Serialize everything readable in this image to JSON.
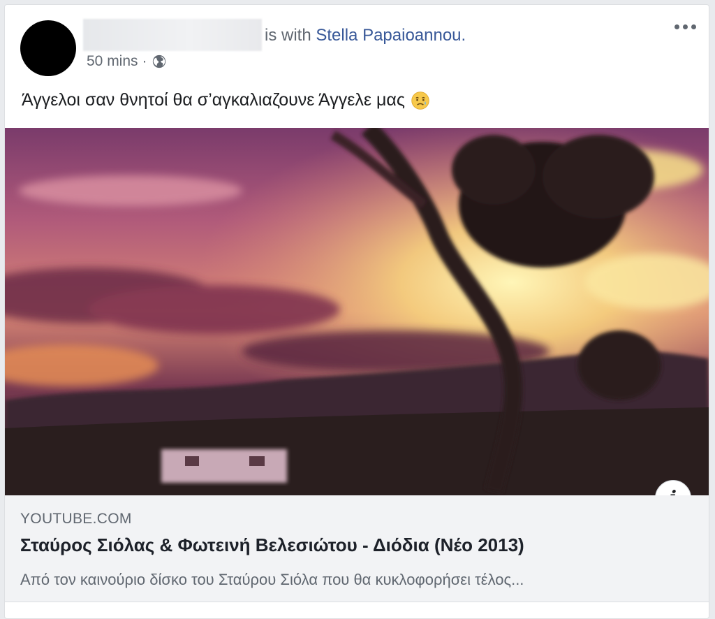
{
  "post": {
    "with_text": "is with",
    "tagged_name": "Stella Papaioannou.",
    "timestamp": "50 mins",
    "separator": "·",
    "audience_icon": "globe-icon",
    "body_text": "Άγγελοι σαν θνητοί θα σ’αγκαλιαζουνε Άγγελε μας",
    "emoji": "sad-but-relieved-face"
  },
  "link_preview": {
    "domain": "YOUTUBE.COM",
    "title": "Σταύρος Σιόλας & Φωτεινή Βελεσιώτου - Διόδια (Νέο 2013)",
    "description": "Από τον καινούριο δίσκο του Σταύρου Σιόλα που θα κυκλοφορήσει τέλος...",
    "info_glyph": "i"
  },
  "colors": {
    "link_blue": "#385898",
    "meta_gray": "#606770",
    "card_bg": "#ffffff",
    "preview_bg": "#f2f3f5"
  }
}
